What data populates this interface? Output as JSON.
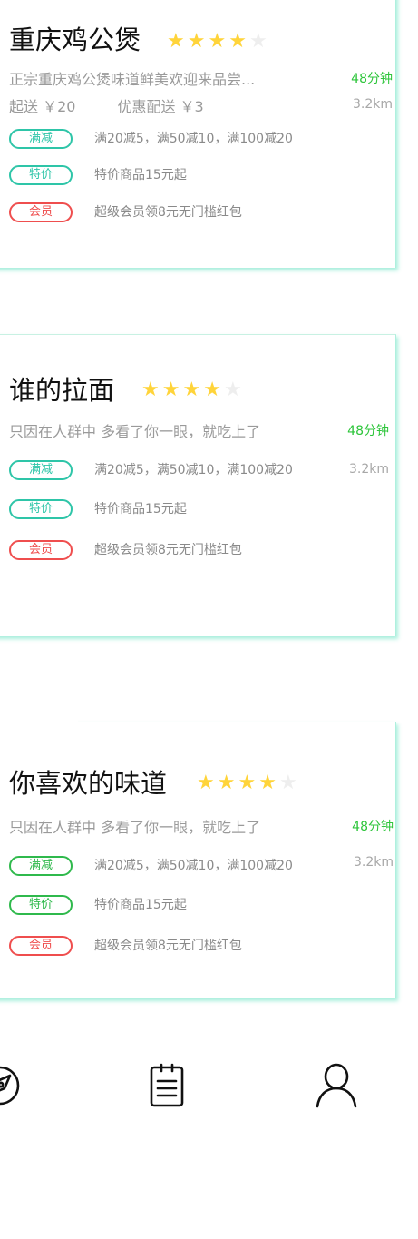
{
  "stores": [
    {
      "name": "重庆鸡公煲",
      "rating": 4,
      "rating_max": 5,
      "description": "正宗重庆鸡公煲味道鲜美欢迎来品尝...",
      "min_order": "起送 ￥20",
      "delivery_fee": "优惠配送 ￥3",
      "time": "48分钟",
      "distance": "3.2km",
      "promos": [
        {
          "tag": "满减",
          "text": "满20减5，满50减10，满100减20",
          "style": "teal"
        },
        {
          "tag": "特价",
          "text": "特价商品15元起",
          "style": "teal"
        },
        {
          "tag": "会员",
          "text": "超级会员领8元无门槛红包",
          "style": "red"
        }
      ]
    },
    {
      "name": "谁的拉面",
      "rating": 4,
      "rating_max": 5,
      "description": "只因在人群中 多看了你一眼，就吃上了",
      "time": "48分钟",
      "distance": "3.2km",
      "promos": [
        {
          "tag": "满减",
          "text": "满20减5，满50减10，满100减20",
          "style": "teal"
        },
        {
          "tag": "特价",
          "text": "特价商品15元起",
          "style": "teal"
        },
        {
          "tag": "会员",
          "text": "超级会员领8元无门槛红包",
          "style": "red"
        }
      ]
    },
    {
      "name": "你喜欢的味道",
      "rating": 4,
      "rating_max": 5,
      "description": "只因在人群中 多看了你一眼，就吃上了",
      "time": "48分钟",
      "distance": "3.2km",
      "promos": [
        {
          "tag": "满减",
          "text": "满20减5，满50减10，满100减20",
          "style": "green"
        },
        {
          "tag": "特价",
          "text": "特价商品15元起",
          "style": "green"
        },
        {
          "tag": "会员",
          "text": "超级会员领8元无门槛红包",
          "style": "red"
        }
      ]
    }
  ],
  "tabbar": {
    "items": [
      {
        "icon": "discover-icon"
      },
      {
        "icon": "orders-icon"
      },
      {
        "icon": "profile-icon"
      }
    ]
  },
  "colors": {
    "star_on": "#ffd43a",
    "star_off": "#eeeeee",
    "time_green": "#2ec53b",
    "tag_teal": "#2ec5a8",
    "tag_green": "#2fb94c",
    "tag_red": "#ef4e4e",
    "card_shadow": "#40dcb4"
  }
}
